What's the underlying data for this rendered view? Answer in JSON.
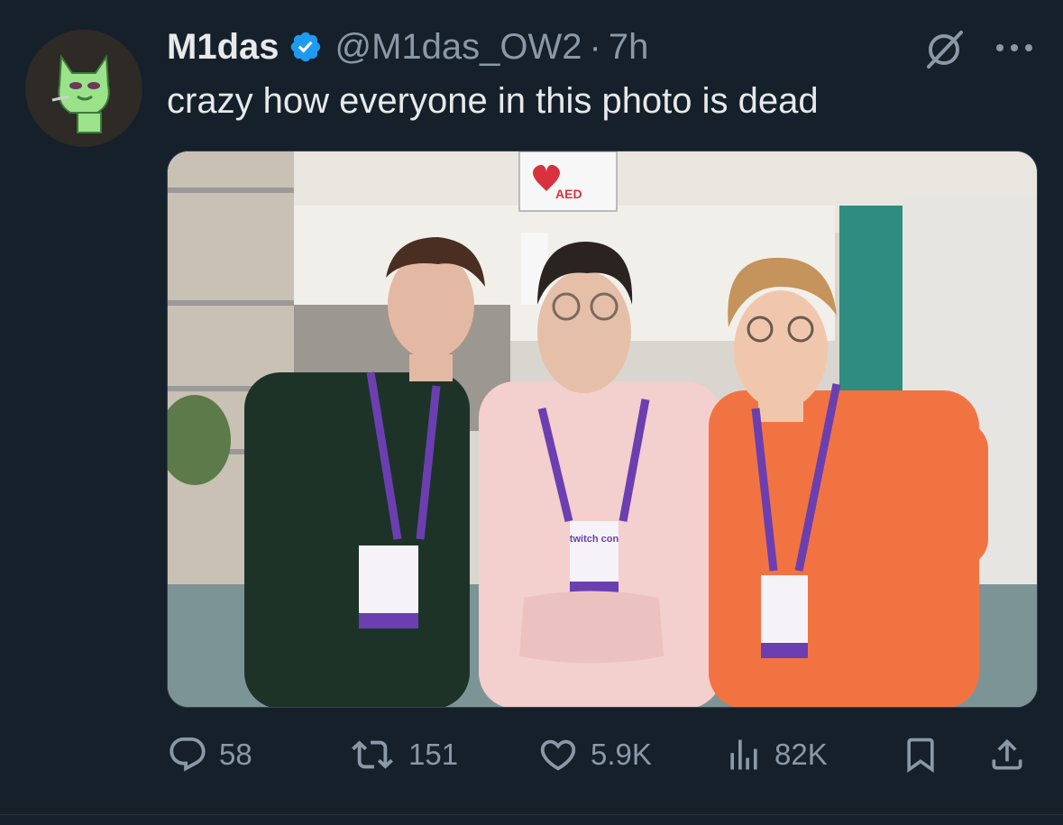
{
  "tweet": {
    "author_name": "M1das",
    "handle": "@M1das_OW2",
    "separator": "·",
    "time": "7h",
    "text": "crazy how everyone in this photo is dead",
    "verified": true
  },
  "photo": {
    "sign_aed": "AED",
    "badge_brand": "twitch con"
  },
  "actions": {
    "replies": "58",
    "reposts": "151",
    "likes": "5.9K",
    "views": "82K"
  },
  "colors": {
    "background": "#15202b",
    "text": "#e7e9ea",
    "muted": "#8b98a5",
    "verified_blue": "#1d9bf0"
  },
  "icons": [
    "grok-icon",
    "more-icon",
    "reply-icon",
    "repost-icon",
    "like-icon",
    "views-icon",
    "bookmark-icon",
    "share-icon"
  ]
}
